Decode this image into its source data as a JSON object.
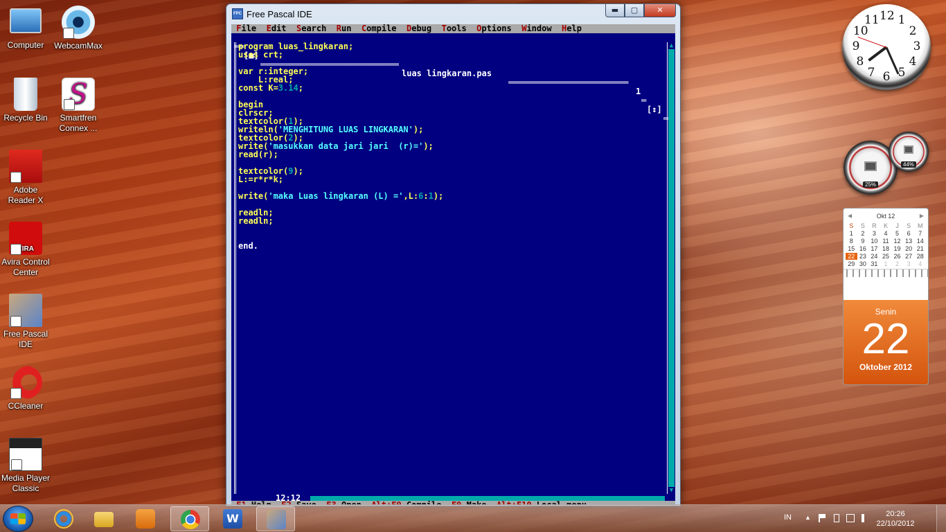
{
  "desktop": {
    "icons": [
      {
        "label_1": "Computer",
        "label_2": ""
      },
      {
        "label_1": "WebcamMax",
        "label_2": ""
      },
      {
        "label_1": "Recycle Bin",
        "label_2": ""
      },
      {
        "label_1": "Smartfren",
        "label_2": "Connex ..."
      },
      {
        "label_1": "Adobe",
        "label_2": "Reader X"
      },
      {
        "label_1": "Avira Control",
        "label_2": "Center"
      },
      {
        "label_1": "Free Pascal",
        "label_2": "IDE"
      },
      {
        "label_1": "CCleaner",
        "label_2": ""
      },
      {
        "label_1": "Media Player",
        "label_2": "Classic"
      }
    ]
  },
  "window": {
    "title": "Free Pascal IDE",
    "icon_text": "FPC",
    "minimize_glyph": "▬",
    "maximize_glyph": "▢",
    "close_glyph": "✕"
  },
  "ide": {
    "menu": [
      {
        "hotkey": "F",
        "rest": "ile"
      },
      {
        "hotkey": "E",
        "rest": "dit"
      },
      {
        "hotkey": "S",
        "rest": "earch"
      },
      {
        "hotkey": "R",
        "rest": "un"
      },
      {
        "hotkey": "C",
        "rest": "ompile"
      },
      {
        "hotkey": "D",
        "rest": "ebug"
      },
      {
        "hotkey": "T",
        "rest": "ools"
      },
      {
        "hotkey": "O",
        "rest": "ptions"
      },
      {
        "hotkey": "W",
        "rest": "indow"
      },
      {
        "hotkey": "H",
        "rest": "elp"
      }
    ],
    "close_box": "[■]",
    "filename": "luas lingkaran.pas",
    "window_number": "1",
    "zoom_box": "[↕]",
    "cursor_pos": "12:12",
    "code": [
      [
        {
          "t": "program luas_lingkaran;",
          "c": "y"
        }
      ],
      [
        {
          "t": "uses crt;",
          "c": "y"
        }
      ],
      [],
      [
        {
          "t": "var ",
          "c": "y"
        },
        {
          "t": "r:integer;",
          "c": "y"
        }
      ],
      [
        {
          "t": "    L:real;",
          "c": "y"
        }
      ],
      [
        {
          "t": "const K=",
          "c": "y"
        },
        {
          "t": "3.14",
          "c": "n"
        },
        {
          "t": ";",
          "c": "y"
        }
      ],
      [],
      [
        {
          "t": "begin",
          "c": "y"
        }
      ],
      [
        {
          "t": "clrscr;",
          "c": "y"
        }
      ],
      [
        {
          "t": "textcolor(",
          "c": "y"
        },
        {
          "t": "1",
          "c": "n"
        },
        {
          "t": ");",
          "c": "y"
        }
      ],
      [
        {
          "t": "writeln(",
          "c": "y"
        },
        {
          "t": "'MENGHITUNG LUAS LINGKARAN'",
          "c": "s"
        },
        {
          "t": ");",
          "c": "y"
        }
      ],
      [
        {
          "t": "textcolor(",
          "c": "y"
        },
        {
          "t": "2",
          "c": "n"
        },
        {
          "t": ");",
          "c": "y"
        }
      ],
      [
        {
          "t": "write(",
          "c": "y"
        },
        {
          "t": "'masukkan data jari jari  (r)='",
          "c": "s"
        },
        {
          "t": ");",
          "c": "y"
        }
      ],
      [
        {
          "t": "read(r);",
          "c": "y"
        }
      ],
      [],
      [
        {
          "t": "textcolor(",
          "c": "y"
        },
        {
          "t": "9",
          "c": "n"
        },
        {
          "t": ");",
          "c": "y"
        }
      ],
      [
        {
          "t": "L:=r*r*k;",
          "c": "y"
        }
      ],
      [],
      [
        {
          "t": "write(",
          "c": "y"
        },
        {
          "t": "'maka Luas lingkaran (L) ='",
          "c": "s"
        },
        {
          "t": ",L:",
          "c": "y"
        },
        {
          "t": "6",
          "c": "n"
        },
        {
          "t": ":",
          "c": "y"
        },
        {
          "t": "1",
          "c": "n"
        },
        {
          "t": ");",
          "c": "y"
        }
      ],
      [],
      [
        {
          "t": "readln;",
          "c": "y"
        }
      ],
      [
        {
          "t": "readln;",
          "c": "y"
        }
      ],
      [],
      [],
      [
        {
          "t": "end.",
          "c": "w"
        }
      ]
    ],
    "status": [
      {
        "hotkey": "F1",
        "rest": " Help"
      },
      {
        "hotkey": "F2",
        "rest": " Save"
      },
      {
        "hotkey": "F3",
        "rest": " Open"
      },
      {
        "hotkey": "Alt+F9",
        "rest": " Compile"
      },
      {
        "hotkey": "F9",
        "rest": " Make"
      },
      {
        "hotkey": "Alt+F10",
        "rest": " Local menu"
      }
    ]
  },
  "gadgets": {
    "clock": {
      "numbers": [
        "12",
        "1",
        "2",
        "3",
        "4",
        "5",
        "6",
        "7",
        "8",
        "9",
        "10",
        "11"
      ]
    },
    "cpu_meter": {
      "cpu_percent": "25%",
      "mem_percent": "44%"
    },
    "calendar": {
      "month_label": "Okt 12",
      "prev": "◀",
      "next": "▶",
      "day_headers": [
        "S",
        "S",
        "R",
        "K",
        "J",
        "S",
        "M"
      ],
      "weeks": [
        [
          "1",
          "2",
          "3",
          "4",
          "5",
          "6",
          "7"
        ],
        [
          "8",
          "9",
          "10",
          "11",
          "12",
          "13",
          "14"
        ],
        [
          "15",
          "16",
          "17",
          "18",
          "19",
          "20",
          "21"
        ],
        [
          "22",
          "23",
          "24",
          "25",
          "26",
          "27",
          "28"
        ],
        [
          "29",
          "30",
          "31",
          "1",
          "2",
          "3",
          "4"
        ]
      ],
      "weekday": "Senin",
      "day": "22",
      "month_year": "Oktober 2012"
    }
  },
  "taskbar": {
    "language": "IN",
    "time": "20:26",
    "date": "22/10/2012",
    "colors": {
      "accent": "#1b5fb3"
    }
  }
}
